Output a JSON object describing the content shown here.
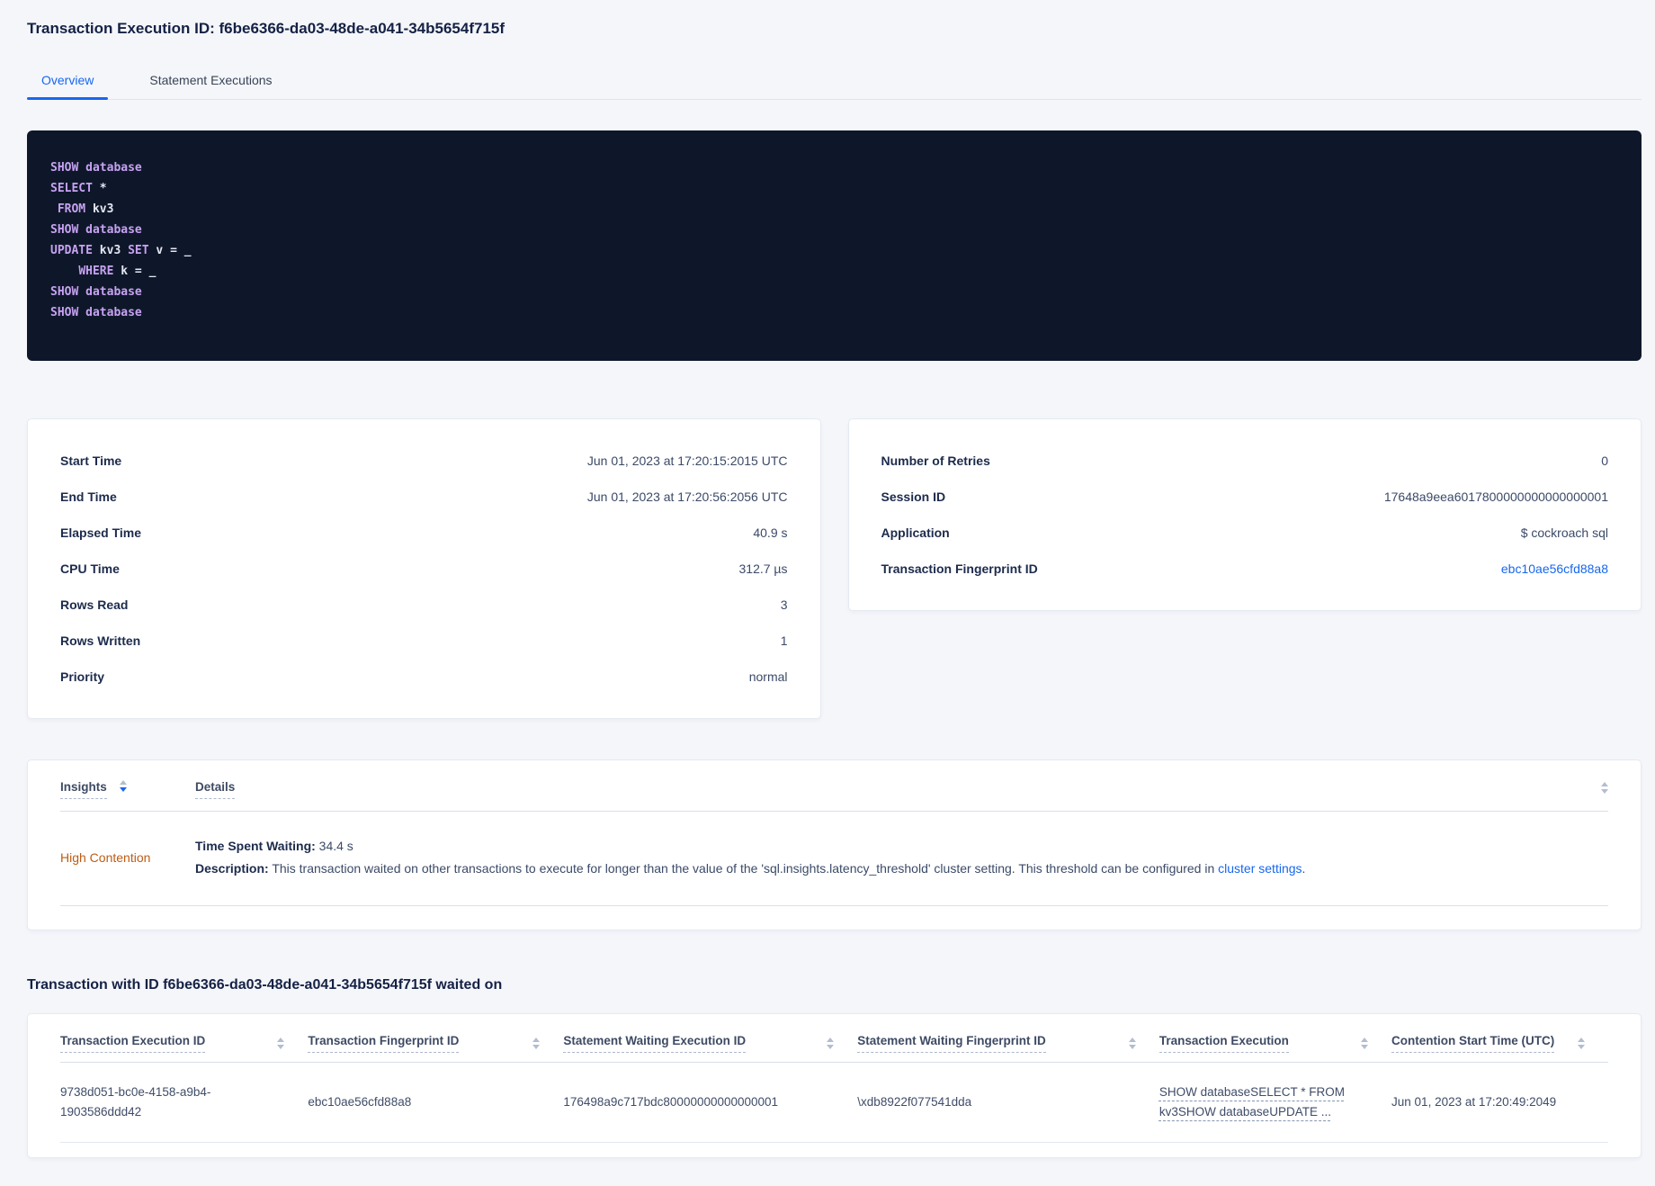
{
  "page": {
    "title": "Transaction Execution ID: f6be6366-da03-48de-a041-34b5654f715f",
    "tabs": {
      "overview": "Overview",
      "statement_executions": "Statement Executions"
    }
  },
  "colors": {
    "accent_blue": "#1767f0",
    "insight_orange": "#bd5c13",
    "code_background": "#0e1729",
    "code_keyword": "#c7a2f2",
    "code_plain": "#e4e7f2"
  },
  "sql": {
    "lines": [
      [
        {
          "t": "SHOW database",
          "kw": true
        }
      ],
      [
        {
          "t": "SELECT",
          "kw": true
        },
        {
          "t": " *"
        }
      ],
      [
        {
          "t": " "
        },
        {
          "t": "FROM",
          "kw": true
        },
        {
          "t": " kv3"
        }
      ],
      [
        {
          "t": "SHOW database",
          "kw": true
        }
      ],
      [
        {
          "t": "UPDATE",
          "kw": true
        },
        {
          "t": " kv3 "
        },
        {
          "t": "SET",
          "kw": true
        },
        {
          "t": " v = _"
        }
      ],
      [
        {
          "t": "    "
        },
        {
          "t": "WHERE",
          "kw": true
        },
        {
          "t": " k = _"
        }
      ],
      [
        {
          "t": "SHOW database",
          "kw": true
        }
      ],
      [
        {
          "t": "SHOW database",
          "kw": true
        }
      ]
    ]
  },
  "summary_left": {
    "rows": [
      {
        "label": "Start Time",
        "value": "Jun 01, 2023 at 17:20:15:2015 UTC"
      },
      {
        "label": "End Time",
        "value": "Jun 01, 2023 at 17:20:56:2056 UTC"
      },
      {
        "label": "Elapsed Time",
        "value": "40.9 s"
      },
      {
        "label": "CPU Time",
        "value": "312.7 µs"
      },
      {
        "label": "Rows Read",
        "value": "3"
      },
      {
        "label": "Rows Written",
        "value": "1"
      },
      {
        "label": "Priority",
        "value": "normal"
      }
    ]
  },
  "summary_right": {
    "rows": [
      {
        "label": "Number of Retries",
        "value": "0"
      },
      {
        "label": "Session ID",
        "value": "17648a9eea6017800000000000000001"
      },
      {
        "label": "Application",
        "value": "$ cockroach sql"
      },
      {
        "label": "Transaction Fingerprint ID",
        "value": "ebc10ae56cfd88a8"
      }
    ]
  },
  "insights_table": {
    "headers": {
      "insights": "Insights",
      "details": "Details"
    },
    "row": {
      "insight": "High Contention",
      "waiting_label": "Time Spent Waiting:",
      "waiting_value": " 34.4 s",
      "description_label": "Description:",
      "description_text": " This transaction waited on other transactions to execute for longer than the value of the 'sql.insights.latency_threshold' cluster setting. This threshold can be configured in ",
      "description_link": "cluster settings",
      "description_suffix": "."
    }
  },
  "waited_on": {
    "heading": "Transaction with ID f6be6366-da03-48de-a041-34b5654f715f waited on",
    "headers": [
      "Transaction Execution ID",
      "Transaction Fingerprint ID",
      "Statement Waiting Execution ID",
      "Statement Waiting Fingerprint ID",
      "Transaction Execution",
      "Contention Start Time (UTC)"
    ],
    "rows": [
      {
        "transaction_execution_id": "9738d051-bc0e-4158-a9b4-1903586ddd42",
        "transaction_fingerprint_id": "ebc10ae56cfd88a8",
        "statement_waiting_execution_id": "176498a9c717bdc80000000000000001",
        "statement_waiting_fingerprint_id": "\\xdb8922f077541dda",
        "transaction_execution": "SHOW databaseSELECT * FROM kv3SHOW databaseUPDATE ...",
        "contention_start_time": "Jun 01, 2023 at 17:20:49:2049"
      }
    ]
  }
}
